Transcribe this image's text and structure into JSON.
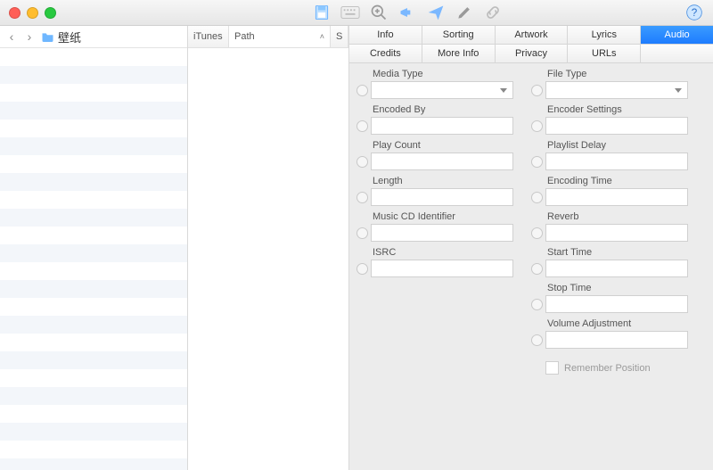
{
  "sidebar": {
    "folder_label": "壁纸"
  },
  "columns": {
    "itunes": "iTunes",
    "path": "Path",
    "third": "S"
  },
  "tabs": {
    "row1": [
      "Info",
      "Sorting",
      "Artwork",
      "Lyrics",
      "Audio"
    ],
    "row2": [
      "Credits",
      "More Info",
      "Privacy",
      "URLs",
      ""
    ],
    "selected": "Audio"
  },
  "fields": {
    "left": [
      {
        "label": "Media Type",
        "type": "select"
      },
      {
        "label": "Encoded By",
        "type": "text"
      },
      {
        "label": "Play Count",
        "type": "text"
      },
      {
        "label": "Length",
        "type": "text"
      },
      {
        "label": "Music CD Identifier",
        "type": "text"
      },
      {
        "label": "ISRC",
        "type": "text"
      }
    ],
    "right": [
      {
        "label": "File Type",
        "type": "select"
      },
      {
        "label": "Encoder Settings",
        "type": "text"
      },
      {
        "label": "Playlist Delay",
        "type": "text"
      },
      {
        "label": "Encoding Time",
        "type": "text"
      },
      {
        "label": "Reverb",
        "type": "text"
      },
      {
        "label": "Start Time",
        "type": "text"
      },
      {
        "label": "Stop Time",
        "type": "text"
      },
      {
        "label": "Volume Adjustment",
        "type": "text"
      }
    ],
    "remember": "Remember Position"
  }
}
